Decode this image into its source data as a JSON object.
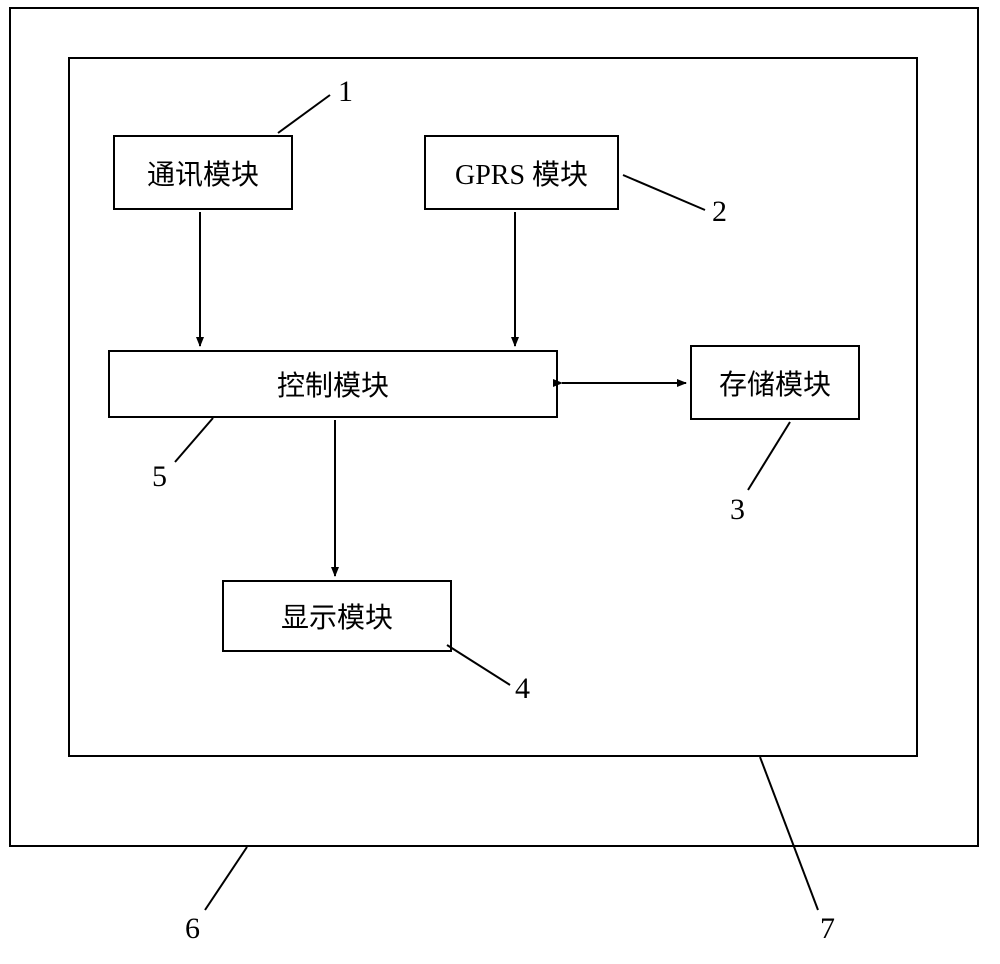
{
  "blocks": {
    "comm": {
      "label": "通讯模块"
    },
    "gprs": {
      "label": "GPRS 模块"
    },
    "control": {
      "label": "控制模块"
    },
    "storage": {
      "label": "存储模块"
    },
    "display": {
      "label": "显示模块"
    }
  },
  "labels": {
    "n1": "1",
    "n2": "2",
    "n3": "3",
    "n4": "4",
    "n5": "5",
    "n6": "6",
    "n7": "7"
  }
}
